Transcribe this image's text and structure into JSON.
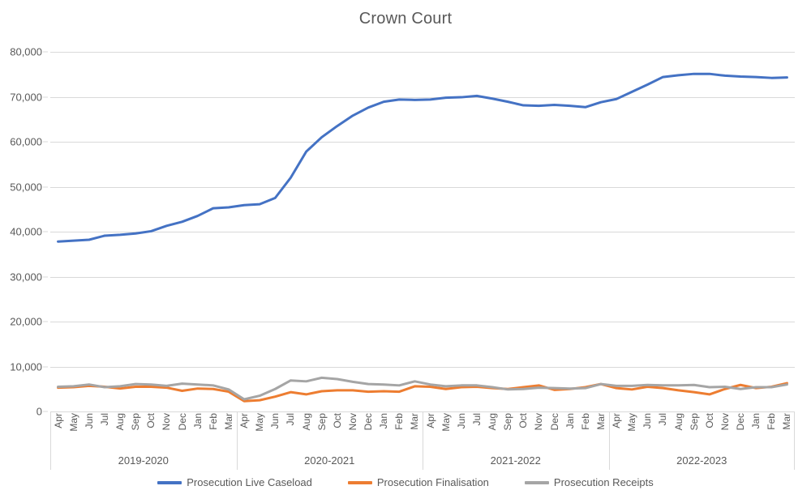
{
  "chart_data": {
    "type": "line",
    "title": "Crown Court",
    "xlabel": "",
    "ylabel": "",
    "ylim": [
      0,
      80000
    ],
    "ytick_interval": 10000,
    "ytick_labels": [
      "80,000",
      "70,000",
      "60,000",
      "50,000",
      "40,000",
      "30,000",
      "20,000",
      "10,000",
      "0"
    ],
    "ytick_values": [
      80000,
      70000,
      60000,
      50000,
      40000,
      30000,
      20000,
      10000,
      0
    ],
    "grid": true,
    "legend_position": "bottom",
    "x_groups": [
      {
        "label": "2019-2020",
        "months": [
          "Apr",
          "May",
          "Jun",
          "Jul",
          "Aug",
          "Sep",
          "Oct",
          "Nov",
          "Dec",
          "Jan",
          "Feb",
          "Mar"
        ]
      },
      {
        "label": "2020-2021",
        "months": [
          "Apr",
          "May",
          "Jun",
          "Jul",
          "Aug",
          "Sep",
          "Oct",
          "Nov",
          "Dec",
          "Jan",
          "Feb",
          "Mar"
        ]
      },
      {
        "label": "2021-2022",
        "months": [
          "Apr",
          "May",
          "Jun",
          "Jul",
          "Aug",
          "Sep",
          "Oct",
          "Nov",
          "Dec",
          "Jan",
          "Feb",
          "Mar"
        ]
      },
      {
        "label": "2022-2023",
        "months": [
          "Apr",
          "May",
          "Jun",
          "Jul",
          "Aug",
          "Sep",
          "Oct",
          "Nov",
          "Dec",
          "Jan",
          "Feb",
          "Mar"
        ]
      }
    ],
    "categories": [
      "Apr 2019",
      "May 2019",
      "Jun 2019",
      "Jul 2019",
      "Aug 2019",
      "Sep 2019",
      "Oct 2019",
      "Nov 2019",
      "Dec 2019",
      "Jan 2020",
      "Feb 2020",
      "Mar 2020",
      "Apr 2020",
      "May 2020",
      "Jun 2020",
      "Jul 2020",
      "Aug 2020",
      "Sep 2020",
      "Oct 2020",
      "Nov 2020",
      "Dec 2020",
      "Jan 2021",
      "Feb 2021",
      "Mar 2021",
      "Apr 2021",
      "May 2021",
      "Jun 2021",
      "Jul 2021",
      "Aug 2021",
      "Sep 2021",
      "Oct 2021",
      "Nov 2021",
      "Dec 2021",
      "Jan 2022",
      "Feb 2022",
      "Mar 2022",
      "Apr 2022",
      "May 2022",
      "Jun 2022",
      "Jul 2022",
      "Aug 2022",
      "Sep 2022",
      "Oct 2022",
      "Nov 2022",
      "Dec 2022",
      "Jan 2023",
      "Feb 2023",
      "Mar 2023"
    ],
    "series": [
      {
        "name": "Prosecution Live Caseload",
        "color": "#4472C4",
        "values": [
          37800,
          38000,
          38200,
          39100,
          39300,
          39600,
          40100,
          41300,
          42200,
          43500,
          45200,
          45400,
          45900,
          46100,
          47500,
          52000,
          57800,
          61000,
          63500,
          65800,
          67600,
          68900,
          69400,
          69300,
          69400,
          69800,
          69900,
          70200,
          69600,
          68900,
          68100,
          68000,
          68200,
          68000,
          67700,
          68800,
          69500,
          71100,
          72700,
          74400,
          74800,
          75100,
          75100,
          74700,
          74500,
          74400,
          74200,
          74300
        ]
      },
      {
        "name": "Prosecution Finalisation",
        "color": "#ED7D31",
        "values": [
          5300,
          5400,
          5700,
          5500,
          5100,
          5500,
          5500,
          5300,
          4600,
          5100,
          5000,
          4400,
          2300,
          2500,
          3300,
          4300,
          3800,
          4500,
          4700,
          4700,
          4400,
          4500,
          4400,
          5600,
          5500,
          5000,
          5400,
          5500,
          5200,
          5000,
          5400,
          5800,
          4800,
          5000,
          5400,
          6100,
          5200,
          4900,
          5500,
          5200,
          4700,
          4300,
          3800,
          5000,
          5900,
          5200,
          5500,
          6300
        ]
      },
      {
        "name": "Prosecution Receipts",
        "color": "#A5A5A5",
        "values": [
          5500,
          5600,
          6000,
          5400,
          5600,
          6100,
          6000,
          5700,
          6200,
          6000,
          5800,
          4900,
          2700,
          3500,
          5000,
          6900,
          6700,
          7500,
          7200,
          6600,
          6100,
          6000,
          5800,
          6700,
          6000,
          5600,
          5800,
          5800,
          5400,
          4900,
          5000,
          5300,
          5200,
          5100,
          5200,
          6100,
          5700,
          5700,
          5900,
          5800,
          5800,
          5900,
          5400,
          5500,
          5000,
          5400,
          5400,
          6000
        ]
      }
    ]
  },
  "title": "Crown Court",
  "legend": {
    "items": [
      {
        "label": "Prosecution Live Caseload",
        "color": "#4472C4"
      },
      {
        "label": "Prosecution Finalisation",
        "color": "#ED7D31"
      },
      {
        "label": "Prosecution Receipts",
        "color": "#A5A5A5"
      }
    ]
  }
}
